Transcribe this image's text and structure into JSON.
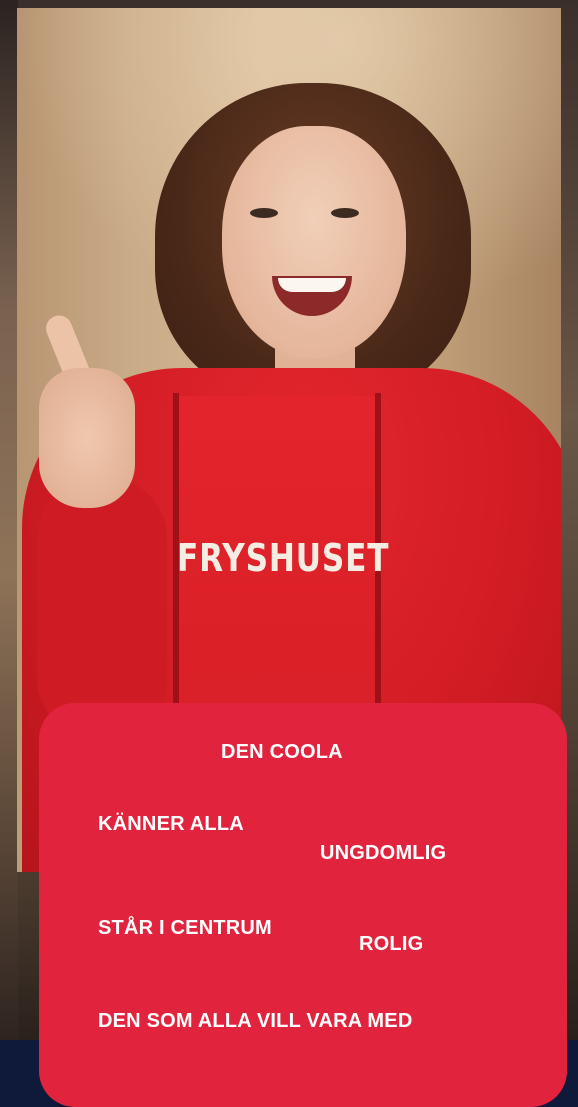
{
  "photo": {
    "shirt_print": "FRYSHUSET"
  },
  "card": {
    "tags": [
      "DEN COOLA",
      "KÄNNER ALLA",
      "UNGDOMLIG",
      "STÅR I CENTRUM",
      "ROLIG",
      "DEN SOM ALLA VILL VARA MED"
    ]
  },
  "colors": {
    "card_background": "#e2233d",
    "page_background": "#0f1a3a",
    "tag_text": "#ffffff"
  }
}
